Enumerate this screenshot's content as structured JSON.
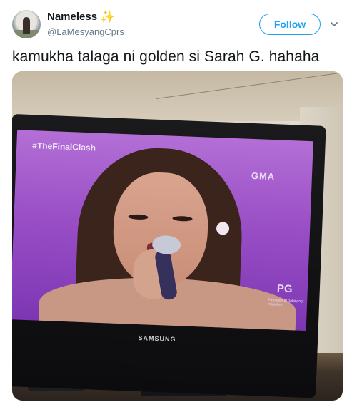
{
  "tweet": {
    "display_name": "Nameless",
    "sparkle_glyph": "✨",
    "handle": "@LaMesyangCprs",
    "follow_label": "Follow",
    "text": "kamukha talaga ni golden si Sarah G. hahaha"
  },
  "photo": {
    "screen_hashtag": "#TheFinalClash",
    "channel_logo": "GMA",
    "rating_badge": "PG",
    "rating_note": "Patnubay at gabay ng magulang",
    "tv_brand": "SAMSUNG"
  },
  "icons": {
    "menu": "chevron-down-icon",
    "emoji": "sparkle-icon"
  },
  "colors": {
    "accent": "#1da1f2",
    "text": "#14171a",
    "secondary": "#657786"
  }
}
